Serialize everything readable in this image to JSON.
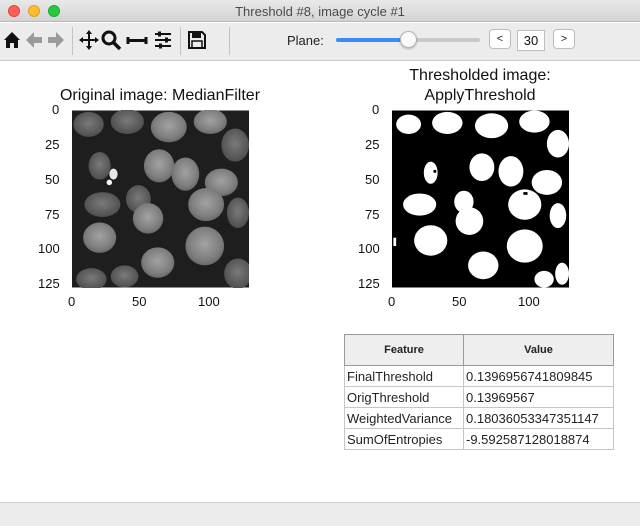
{
  "window": {
    "title": "Threshold #8, image cycle #1"
  },
  "toolbar": {
    "icons": [
      "home-icon",
      "back-arrow-icon",
      "forward-arrow-icon",
      "pan-icon",
      "zoom-icon",
      "subplot-adjust-icon",
      "configure-icon",
      "save-icon"
    ],
    "plane_label": "Plane:",
    "slider_fraction": 0.5,
    "prev_label": "<",
    "next_label": ">",
    "plane_value": "30"
  },
  "plots": {
    "original": {
      "title": "Original image: MedianFilter",
      "y_ticks": [
        "0",
        "25",
        "50",
        "75",
        "100",
        "125"
      ],
      "x_ticks": [
        "0",
        "50",
        "100"
      ]
    },
    "thresholded": {
      "title_line1": "Thresholded image:",
      "title_line2": "ApplyThreshold",
      "y_ticks": [
        "0",
        "25",
        "50",
        "75",
        "100",
        "125"
      ],
      "x_ticks": [
        "0",
        "50",
        "100"
      ]
    }
  },
  "table": {
    "headers": [
      "Feature",
      "Value"
    ],
    "rows": [
      {
        "feature": "FinalThreshold",
        "value": "0.1396956741809845"
      },
      {
        "feature": "OrigThreshold",
        "value": "0.13969567"
      },
      {
        "feature": "WeightedVariance",
        "value": "0.18036053347351147"
      },
      {
        "feature": "SumOfEntropies",
        "value": "-9.592587128018874"
      }
    ]
  },
  "colors": {
    "accent": "#3b8cf6",
    "image_background": "#1a1a1a",
    "nucleus_gray": "#8a8a8a",
    "mask_foreground": "#ffffff",
    "mask_background": "#000000"
  }
}
